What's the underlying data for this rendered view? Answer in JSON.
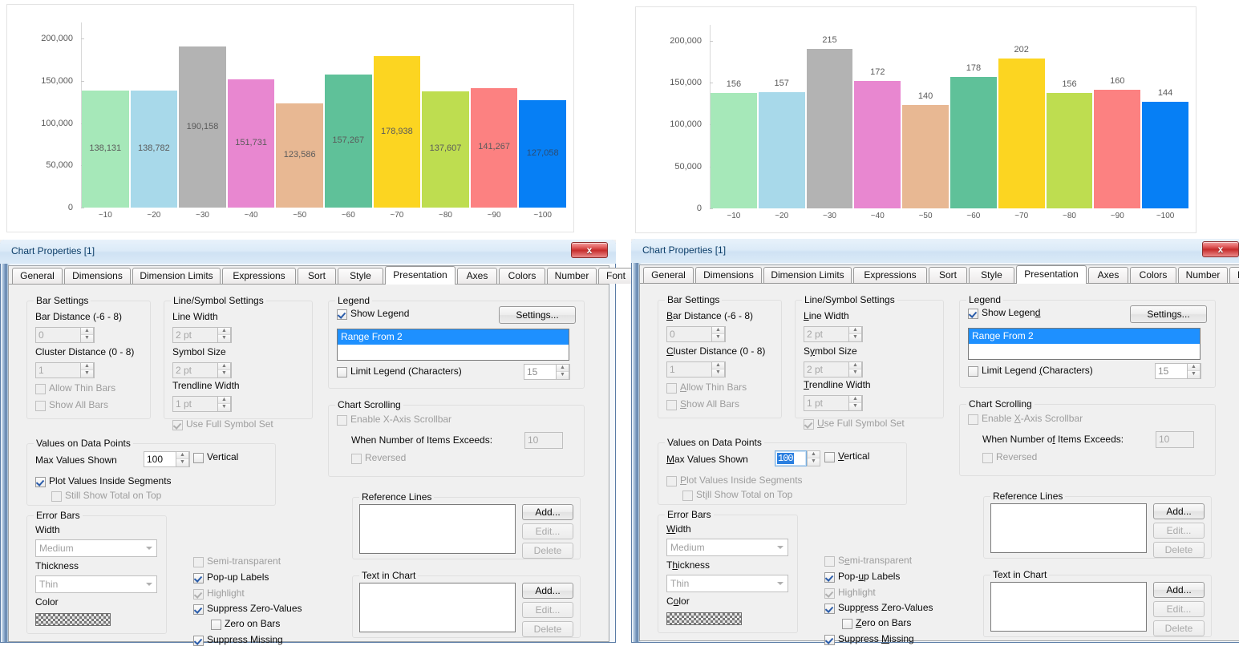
{
  "chart_data": [
    {
      "id": "chart-left",
      "type": "bar",
      "title": "",
      "xlabel": "",
      "ylabel": "",
      "categories": [
        "~10",
        "~20",
        "~30",
        "~40",
        "~50",
        "~60",
        "~70",
        "~80",
        "~90",
        "~100"
      ],
      "values": [
        138131,
        138782,
        190158,
        151731,
        123586,
        157267,
        178938,
        137607,
        141267,
        127058
      ],
      "data_labels": [
        "138,131",
        "138,782",
        "190,158",
        "151,731",
        "123,586",
        "157,267",
        "178,938",
        "137,607",
        "141,267",
        "127,058"
      ],
      "label_position": "inside",
      "colors": [
        "#a6e8b9",
        "#a8d9ea",
        "#b3b3b3",
        "#e887d0",
        "#e8b893",
        "#5fc199",
        "#fcd521",
        "#bedd50",
        "#fc8181",
        "#067ff5"
      ],
      "yticks": [
        "0",
        "50,000",
        "100,000",
        "150,000",
        "200,000"
      ],
      "ytick_values": [
        0,
        50000,
        100000,
        150000,
        200000
      ],
      "ylim": [
        0,
        219000
      ],
      "grid": false,
      "legend": "none"
    },
    {
      "id": "chart-right",
      "type": "bar",
      "title": "",
      "xlabel": "",
      "ylabel": "",
      "categories": [
        "~10",
        "~20",
        "~30",
        "~40",
        "~50",
        "~60",
        "~70",
        "~80",
        "~90",
        "~100"
      ],
      "values": [
        138131,
        138782,
        190158,
        151731,
        123586,
        157267,
        178938,
        137607,
        141267,
        127058
      ],
      "data_labels": [
        "156",
        "157",
        "215",
        "172",
        "140",
        "178",
        "202",
        "156",
        "160",
        "144"
      ],
      "label_position": "top",
      "colors": [
        "#a6e8b9",
        "#a8d9ea",
        "#b3b3b3",
        "#e887d0",
        "#e8b893",
        "#5fc199",
        "#fcd521",
        "#bedd50",
        "#fc8181",
        "#067ff5"
      ],
      "yticks": [
        "0",
        "50,000",
        "100,000",
        "150,000",
        "200,000"
      ],
      "ytick_values": [
        0,
        50000,
        100000,
        150000,
        200000
      ],
      "ylim": [
        0,
        219000
      ],
      "grid": false,
      "legend": "none"
    }
  ],
  "dialog": {
    "title": "Chart Properties [1]",
    "close_label": "x",
    "tabs": [
      {
        "label": "General",
        "active": false
      },
      {
        "label": "Dimensions",
        "active": false
      },
      {
        "label": "Dimension Limits",
        "active": false
      },
      {
        "label": "Expressions",
        "active": false
      },
      {
        "label": "Sort",
        "active": false
      },
      {
        "label": "Style",
        "active": false
      },
      {
        "label": "Presentation",
        "active": true
      },
      {
        "label": "Axes",
        "active": false
      },
      {
        "label": "Colors",
        "active": false
      },
      {
        "label": "Number",
        "active": false
      },
      {
        "label": "Font",
        "active": false
      }
    ],
    "tab_nav_prev": "◄",
    "tab_nav_next": "►",
    "bar_settings": {
      "group": "Bar Settings",
      "bar_distance_label": "Bar Distance (-6 - 8)",
      "bar_distance_value": "0",
      "cluster_distance_label": "Cluster Distance (0 - 8)",
      "cluster_distance_value": "1",
      "allow_thin_bars": "Allow Thin Bars",
      "show_all_bars": "Show All Bars"
    },
    "line_symbol": {
      "group": "Line/Symbol Settings",
      "line_width_label": "Line Width",
      "line_width_value": "2 pt",
      "symbol_size_label": "Symbol Size",
      "symbol_size_value": "2 pt",
      "trendline_width_label": "Trendline Width",
      "trendline_width_value": "1 pt",
      "use_full_symbol_set": "Use Full Symbol Set"
    },
    "values_on_data_points": {
      "group": "Values on Data Points",
      "max_values_shown_label": "Max Values Shown",
      "max_values_shown_value": "100",
      "vertical": "Vertical",
      "plot_values_inside_segments": "Plot Values Inside Segments",
      "still_show_total_on_top": "Still Show Total on Top"
    },
    "error_bars": {
      "group": "Error Bars",
      "width_label": "Width",
      "width_value": "Medium",
      "thickness_label": "Thickness",
      "thickness_value": "Thin",
      "color_label": "Color"
    },
    "right_checks": {
      "semi_transparent": "Semi-transparent",
      "popup_labels": "Pop-up Labels",
      "highlight": "Highlight",
      "suppress_zero_values": "Suppress Zero-Values",
      "zero_on_bars": "Zero on Bars",
      "suppress_missing": "Suppress Missing"
    },
    "legend": {
      "group": "Legend",
      "show_legend": "Show Legend",
      "settings_button": "Settings...",
      "list_item": "Range From 2",
      "limit_legend": "Limit Legend (Characters)",
      "limit_value": "15"
    },
    "chart_scrolling": {
      "group": "Chart Scrolling",
      "enable_x_axis_scrollbar": "Enable X-Axis Scrollbar",
      "when_exceeds_label": "When Number of Items Exceeds:",
      "when_exceeds_value": "10",
      "reversed": "Reversed"
    },
    "reference_lines": {
      "group": "Reference Lines",
      "add": "Add...",
      "edit": "Edit...",
      "delete": "Delete"
    },
    "text_in_chart": {
      "group": "Text in Chart",
      "add": "Add...",
      "edit": "Edit...",
      "delete": "Delete"
    }
  },
  "state": {
    "left": {
      "show_accelerators": false,
      "plot_values_inside_segments_checked": true,
      "max_values_focused": false
    },
    "right": {
      "show_accelerators": true,
      "plot_values_inside_segments_checked": false,
      "max_values_focused": true
    }
  },
  "colors": {
    "selection_blue": "#1e90ff",
    "titlebar_blue": "#cfe2f4",
    "close_red": "#c62c2c"
  }
}
